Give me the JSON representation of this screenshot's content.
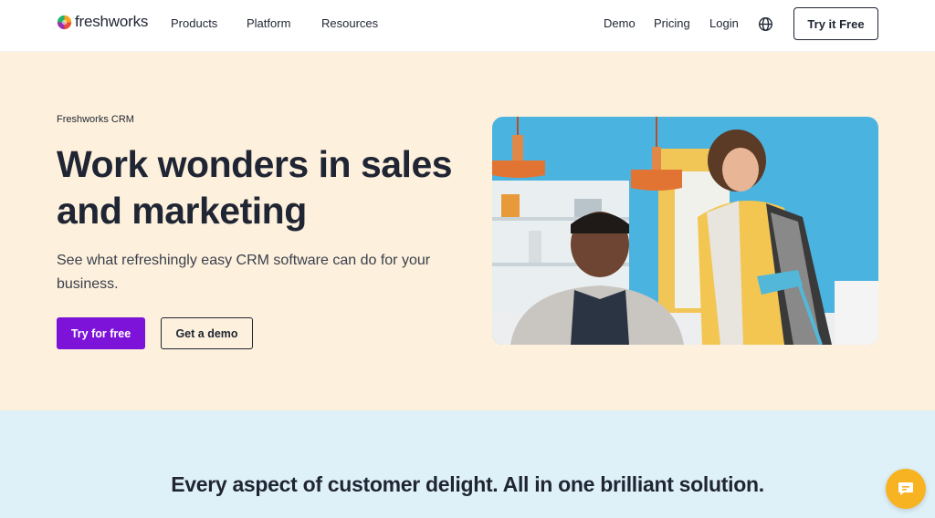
{
  "nav": {
    "logo_text": "freshworks",
    "links": [
      "Products",
      "Platform",
      "Resources"
    ],
    "right_links": [
      "Demo",
      "Pricing",
      "Login"
    ],
    "cta_label": "Try it Free"
  },
  "hero": {
    "eyebrow": "Freshworks CRM",
    "headline": "Work wonders in sales and marketing",
    "subhead": "See what refreshingly easy CRM software can do for your business.",
    "primary_cta": "Try for free",
    "secondary_cta": "Get a demo"
  },
  "lower": {
    "tagline": "Every aspect of customer delight. All in one brilliant solution."
  },
  "colors": {
    "brand_purple": "#7d12d8",
    "hero_bg": "#fdf0dc",
    "lower_bg": "#dff1f8",
    "chat_accent": "#f7b321"
  },
  "icons": [
    "freshworks-logo-icon",
    "globe-icon",
    "chat-icon"
  ]
}
